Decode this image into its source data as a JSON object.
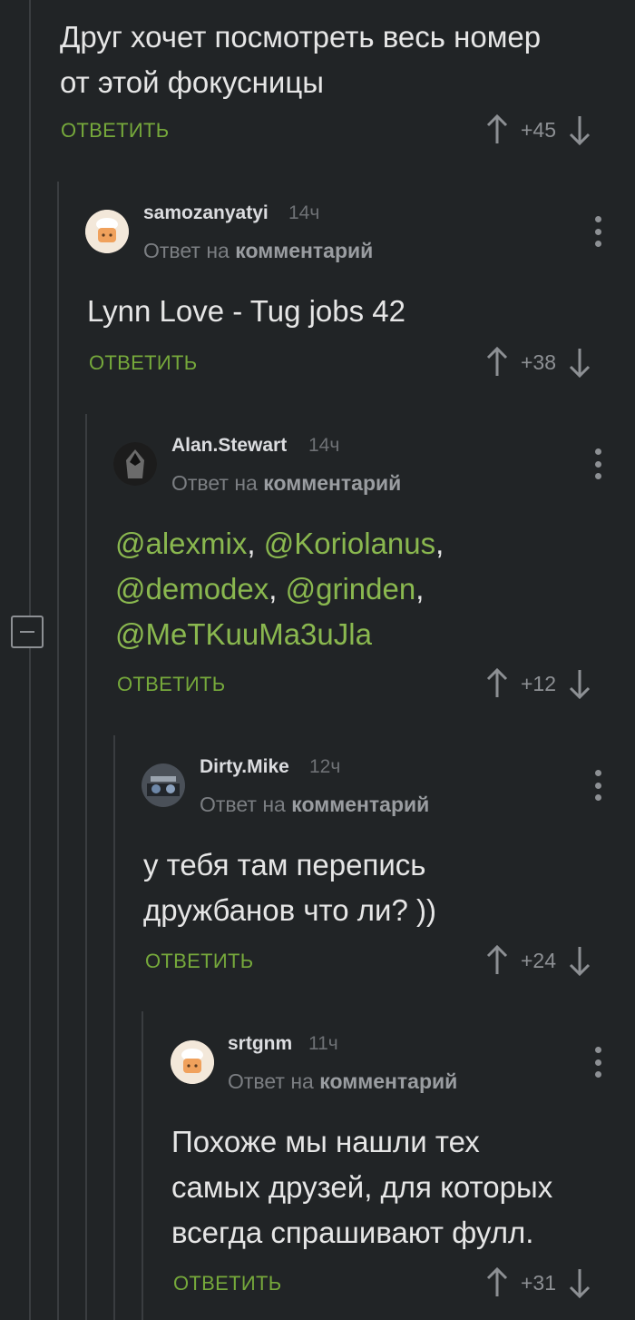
{
  "ui": {
    "reply_label": "ОТВЕТИТЬ",
    "reply_to_prefix": "Ответ на",
    "reply_to_target": "комментарий"
  },
  "colors": {
    "background": "#212426",
    "accent_green": "#76a93b",
    "mention_green": "#8ab84f",
    "muted": "#8d9094"
  },
  "comments": [
    {
      "text_lines": [
        "Друг хочет посмотреть весь номер",
        "от этой фокусницы"
      ],
      "rating": "+45"
    },
    {
      "username": "samozanyatyi",
      "time": "14ч",
      "avatar": "cook-hat-avatar",
      "text_lines": [
        "Lynn Love - Tug jobs 42"
      ],
      "rating": "+38"
    },
    {
      "username": "Alan.Stewart",
      "time": "14ч",
      "avatar": "assassin-avatar",
      "mentions_lines": [
        [
          "@alexmix",
          "@Koriolanus"
        ],
        [
          "@demodex",
          "@grinden"
        ],
        [
          "@MeTKuuMa3uJla"
        ]
      ],
      "rating": "+12"
    },
    {
      "username": "Dirty.Mike",
      "time": "12ч",
      "avatar": "photo-avatar",
      "text_lines": [
        "у тебя там перепись",
        "дружбанов что ли? ))"
      ],
      "rating": "+24"
    },
    {
      "username": "srtgnm",
      "time": "11ч",
      "avatar": "cook-hat-avatar",
      "text_lines": [
        "Похоже мы нашли тех",
        "самых друзей, для которых",
        "всегда спрашивают фулл."
      ],
      "rating": "+31"
    }
  ]
}
